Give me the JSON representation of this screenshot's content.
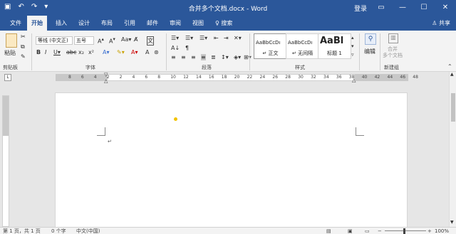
{
  "window": {
    "title": "合并多个文档.docx  -  Word",
    "login": "登录",
    "qat": {
      "save_icon": "save-icon",
      "undo_icon": "undo-icon",
      "redo_icon": "redo-icon"
    },
    "winbtns": {
      "ribbon_options": "▭",
      "minimize": "—",
      "maximize": "☐",
      "close": "✕"
    }
  },
  "tabs": [
    {
      "label": "文件"
    },
    {
      "label": "开始"
    },
    {
      "label": "插入"
    },
    {
      "label": "设计"
    },
    {
      "label": "布局"
    },
    {
      "label": "引用"
    },
    {
      "label": "邮件"
    },
    {
      "label": "审阅"
    },
    {
      "label": "视图"
    }
  ],
  "search": {
    "label": "♀ 搜索"
  },
  "share": {
    "label": "♙ 共享"
  },
  "ribbon": {
    "clipboard": {
      "paste_label": "粘贴",
      "group_label": "剪贴板"
    },
    "font": {
      "font_name": "等线 (中文正)",
      "font_size": "五号",
      "group_label": "字体"
    },
    "paragraph": {
      "group_label": "段落"
    },
    "styles": {
      "group_label": "样式",
      "items": [
        {
          "sample": "AaBbCcDı",
          "name": "↵ 正文"
        },
        {
          "sample": "AaBbCcDı",
          "name": "↵ 无间隔"
        },
        {
          "sample": "AaBl",
          "name": "标题 1"
        }
      ]
    },
    "editing": {
      "label": "编辑"
    },
    "new_group": {
      "merge_label": "合并",
      "merge_label2": "多个文档",
      "group_label": "新建组"
    }
  },
  "ruler": {
    "numbers": [
      "8",
      "6",
      "4",
      "2",
      "2",
      "4",
      "6",
      "8",
      "10",
      "12",
      "14",
      "16",
      "18",
      "20",
      "22",
      "24",
      "26",
      "28",
      "30",
      "32",
      "34",
      "36",
      "38",
      "40",
      "42",
      "44",
      "46",
      "48"
    ]
  },
  "document": {
    "para_mark": "↵"
  },
  "status": {
    "page": "第 1 页，共 1 页",
    "words": "0 个字",
    "lang": "中文(中国)",
    "zoom": "100%"
  }
}
